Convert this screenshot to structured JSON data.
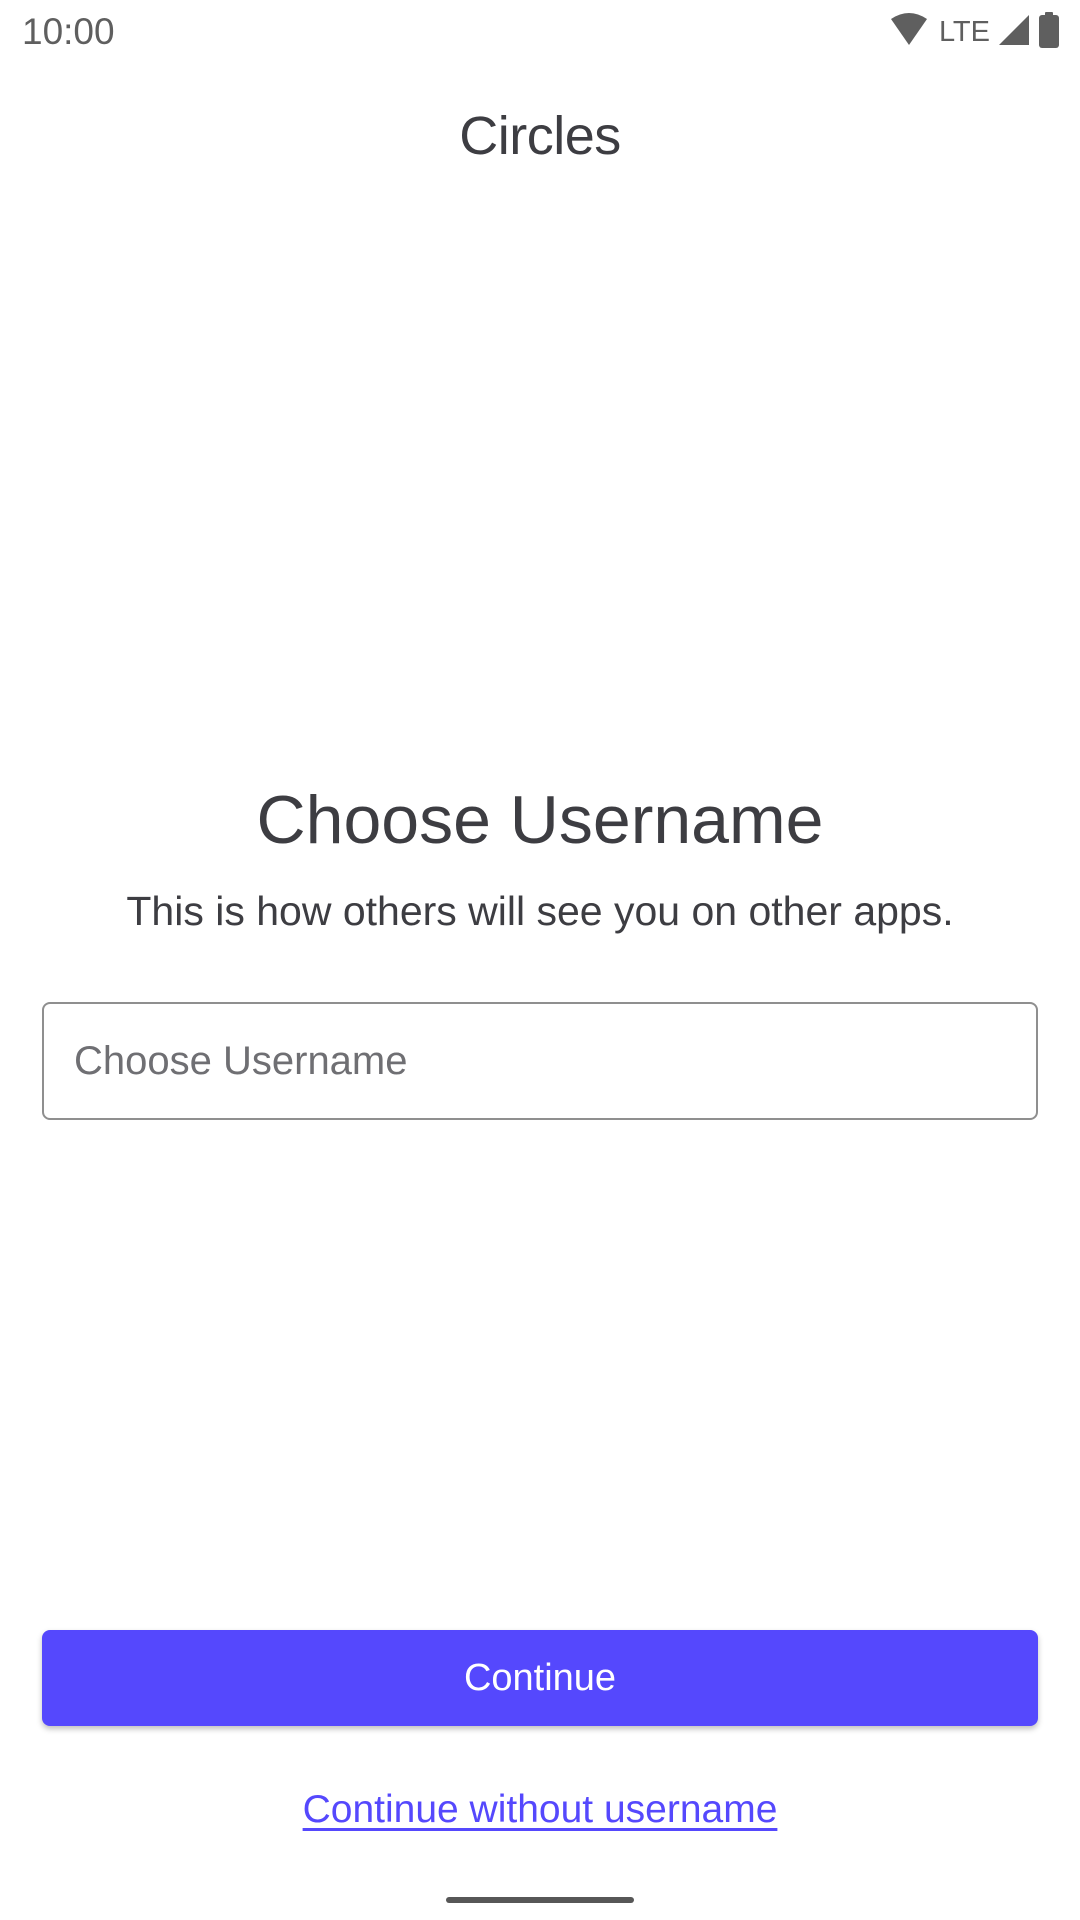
{
  "status_bar": {
    "time": "10:00",
    "network": "LTE",
    "icons": [
      "wifi-icon",
      "cellular-signal-icon",
      "battery-icon"
    ]
  },
  "app": {
    "title": "Circles"
  },
  "main": {
    "heading": "Choose Username",
    "subheading": "This is how others will see you on other apps.",
    "username_input": {
      "value": "",
      "placeholder": "Choose Username"
    }
  },
  "actions": {
    "continue_label": "Continue",
    "skip_label": "Continue without username"
  },
  "colors": {
    "accent": "#5548fd",
    "text": "#3d3d42",
    "input_border": "#8f8f8f"
  }
}
